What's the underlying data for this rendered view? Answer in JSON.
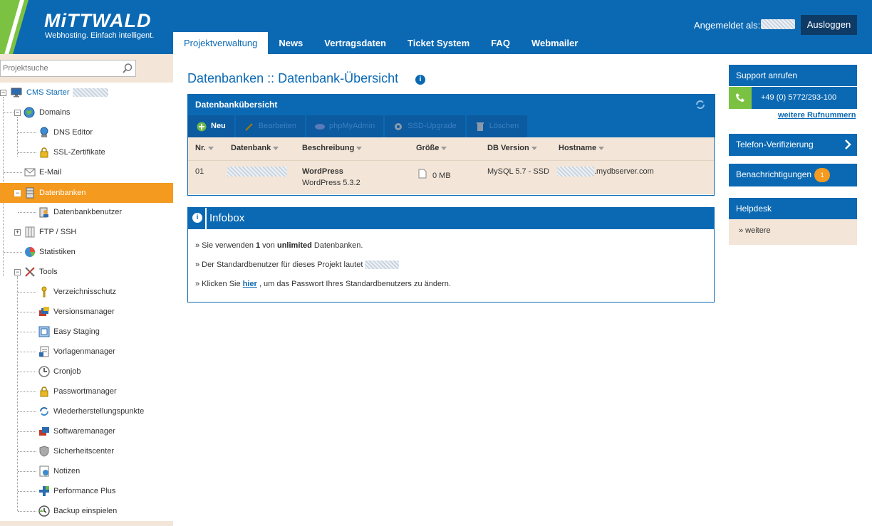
{
  "brand": {
    "name": "MiTTWALD",
    "tagline": "Webhosting. Einfach intelligent."
  },
  "header": {
    "login_label": "Angemeldet als:",
    "logout_label": "Ausloggen"
  },
  "nav": {
    "tabs": [
      "Projektverwaltung",
      "News",
      "Vertragsdaten",
      "Ticket System",
      "FAQ",
      "Webmailer"
    ],
    "active": "Projektverwaltung"
  },
  "sidebar": {
    "search_placeholder": "Projektsuche",
    "project": "CMS Starter",
    "items": {
      "domains": "Domains",
      "dns": "DNS Editor",
      "ssl": "SSL-Zertifikate",
      "email": "E-Mail",
      "datenbanken": "Datenbanken",
      "dbuser": "Datenbankbenutzer",
      "ftp": "FTP / SSH",
      "statistiken": "Statistiken",
      "tools": "Tools",
      "verzeichnisschutz": "Verzeichnisschutz",
      "versionsmanager": "Versionsmanager",
      "easystaging": "Easy Staging",
      "vorlagenmanager": "Vorlagenmanager",
      "cronjob": "Cronjob",
      "passwortmanager": "Passwortmanager",
      "wiederherstellung": "Wiederherstellungspunkte",
      "softwaremanager": "Softwaremanager",
      "sicherheitscenter": "Sicherheitscenter",
      "notizen": "Notizen",
      "performance": "Performance Plus",
      "backup": "Backup einspielen"
    }
  },
  "main": {
    "title": "Datenbanken :: Datenbank-Übersicht",
    "panel_title": "Datenbankübersicht",
    "toolbar": {
      "new": "Neu",
      "edit": "Bearbeiten",
      "phpmyadmin": "phpMyAdmin",
      "ssd": "SSD-Upgrade",
      "delete": "Löschen"
    },
    "columns": {
      "nr": "Nr.",
      "datenbank": "Datenbank",
      "beschreibung": "Beschreibung",
      "groesse": "Größe",
      "dbversion": "DB Version",
      "hostname": "Hostname"
    },
    "row": {
      "nr": "01",
      "beschreibung_title": "WordPress",
      "beschreibung_sub": "WordPress 5.3.2",
      "groesse": "0 MB",
      "dbversion": "MySQL 5.7 - SSD",
      "hostname_suffix": ".mydbserver.com"
    }
  },
  "infobox": {
    "title": "Infobox",
    "line1_pre": "» Sie verwenden ",
    "line1_count": "1",
    "line1_mid": " von ",
    "line1_limit": "unlimited",
    "line1_post": " Datenbanken.",
    "line2": "» Der Standardbenutzer für dieses Projekt lautet",
    "line3_pre": "» Klicken Sie ",
    "line3_link": "hier",
    "line3_post": " , um das Passwort Ihres Standardbenutzers zu ändern."
  },
  "right": {
    "support_title": "Support anrufen",
    "phone": "+49 (0) 5772/293-100",
    "more_numbers": "weitere Rufnummern",
    "verify": "Telefon-Verifizierung",
    "notifications": "Benachrichtigungen",
    "notifications_count": "1",
    "helpdesk": "Helpdesk",
    "helpdesk_more": "» weitere"
  },
  "colors": {
    "brand_blue": "#0b69b3",
    "accent_orange": "#f39a1f",
    "brand_green": "#7cc242",
    "beige": "#f3e6d8"
  }
}
